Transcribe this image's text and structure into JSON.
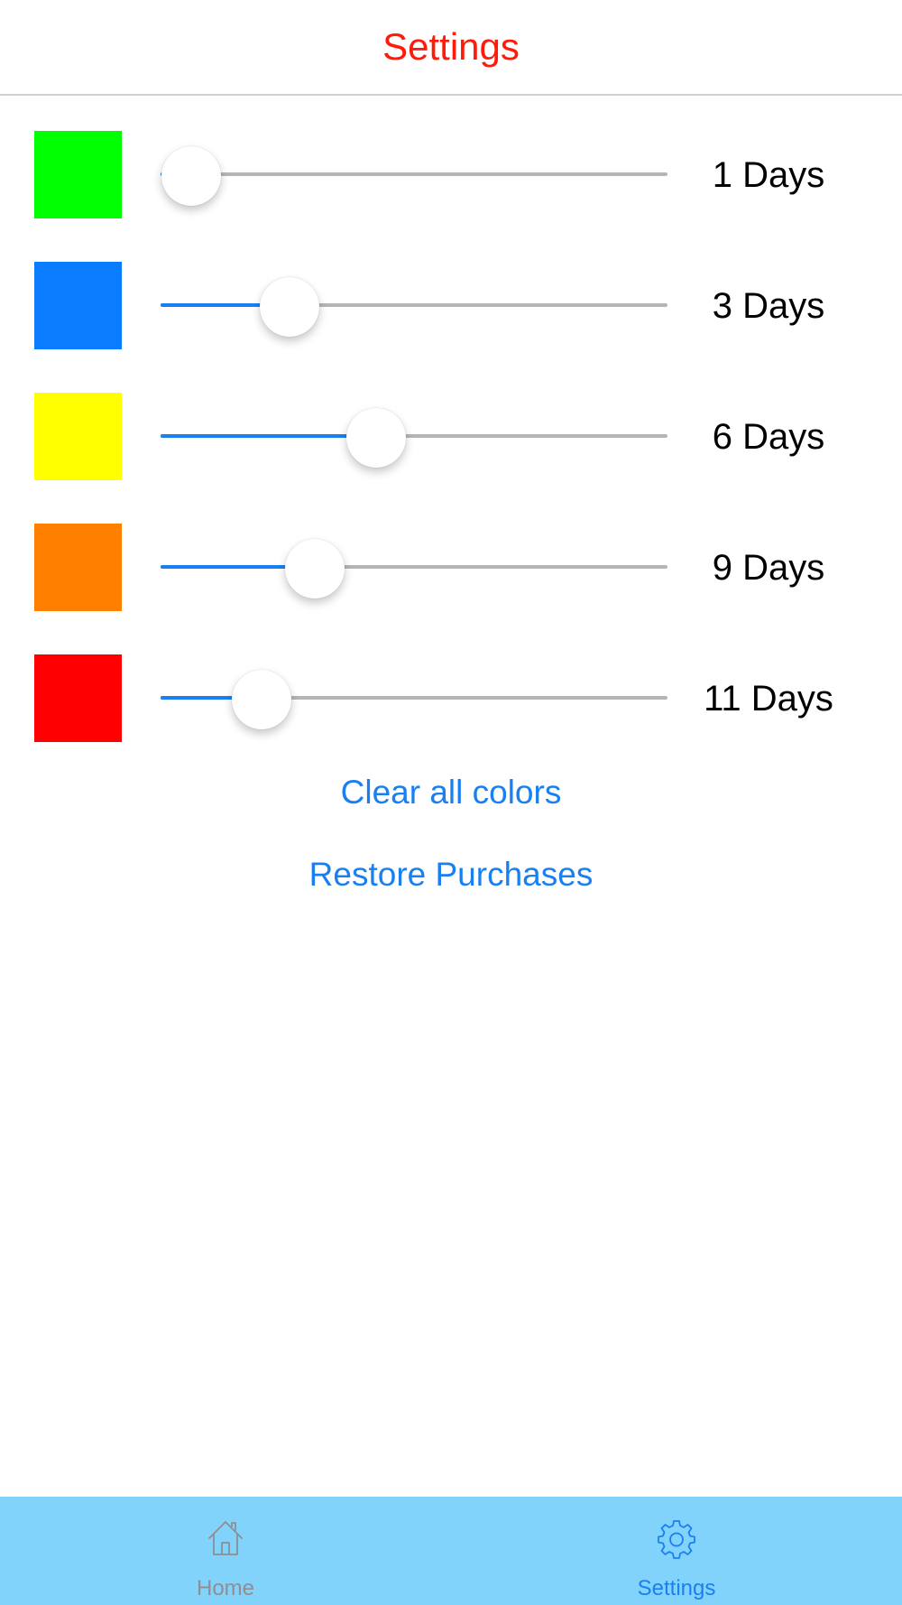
{
  "nav": {
    "title": "Settings",
    "title_color": "#ff1a0a"
  },
  "color_rows": [
    {
      "color": "#00ff00",
      "label": "1 Days",
      "slider_fraction": 0.06
    },
    {
      "color": "#0a7cff",
      "label": "3 Days",
      "slider_fraction": 0.255
    },
    {
      "color": "#ffff00",
      "label": "6 Days",
      "slider_fraction": 0.425
    },
    {
      "color": "#ff7f00",
      "label": "9 Days",
      "slider_fraction": 0.305
    },
    {
      "color": "#ff0000",
      "label": "11 Days",
      "slider_fraction": 0.2
    }
  ],
  "actions": {
    "clear_label": "Clear all colors",
    "restore_label": "Restore Purchases"
  },
  "tabbar": {
    "tabs": [
      {
        "label": "Home",
        "icon": "home-icon",
        "selected": false
      },
      {
        "label": "Settings",
        "icon": "gear-icon",
        "selected": true
      }
    ],
    "background": "#82d3fc",
    "selected_color": "#1a7ff0",
    "unselected_color": "#8e8e93"
  },
  "colors": {
    "accent": "#1a7ff0",
    "track": "#b5b5b5"
  }
}
